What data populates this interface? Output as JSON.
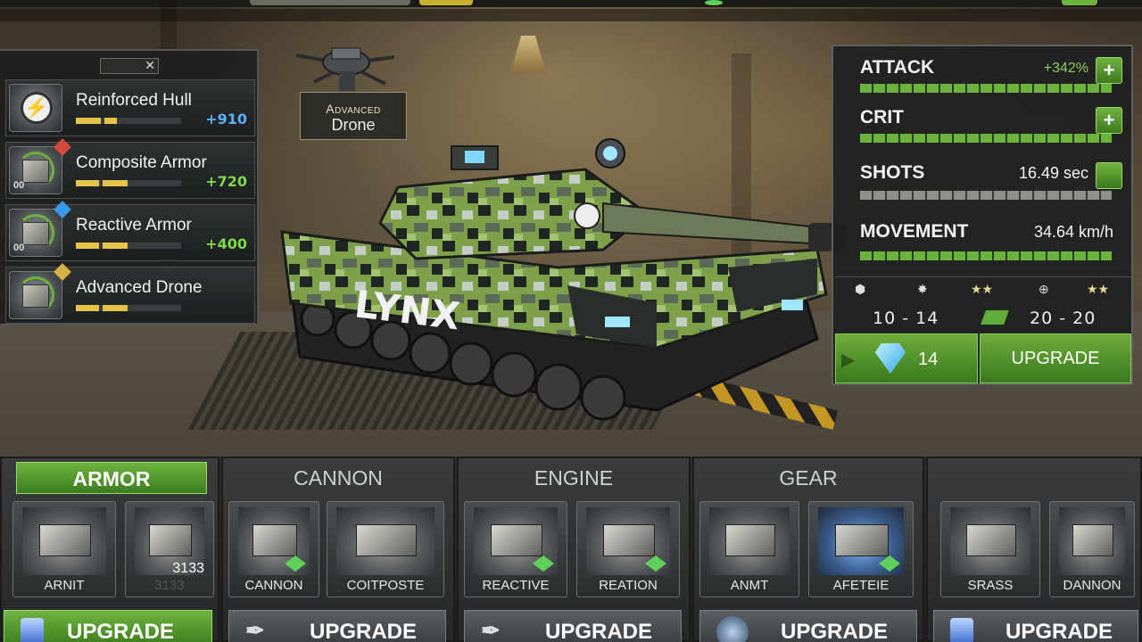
{
  "left_panel": {
    "parts": [
      {
        "name": "Reinforced Hull",
        "bonus": "+910",
        "bonus_color": "#5ab0ff",
        "level": ""
      },
      {
        "name": "Composite Armor",
        "bonus": "+720",
        "bonus_color": "#7fd84a",
        "level": "00"
      },
      {
        "name": "Reactive Armor",
        "bonus": "+400",
        "bonus_color": "#7fd84a",
        "level": "00"
      },
      {
        "name": "Advanced Drone",
        "bonus": "",
        "bonus_color": "#7fd84a",
        "level": ""
      }
    ]
  },
  "drone_label": {
    "line1": "Advanced",
    "line2": "Drone"
  },
  "tank": {
    "name": "LYNX"
  },
  "stats": {
    "attack": {
      "label": "ATTACK",
      "value": "+342%"
    },
    "crit": {
      "label": "CRIT",
      "value": ""
    },
    "shots": {
      "label": "SHOTS",
      "value": "16.49 sec"
    },
    "movement": {
      "label": "MOVEMENT",
      "value": "34.64 km/h"
    },
    "icon_row": [
      "★★",
      "★★"
    ],
    "range_left": "10 - 14",
    "range_right": "20 - 20",
    "gem_count": "14",
    "upgrade_label": "UPGRADE"
  },
  "categories": [
    {
      "title": "ARMOR",
      "cards": [
        {
          "name": "ARNIT",
          "count": ""
        },
        {
          "name": "3133",
          "count": "3133"
        }
      ],
      "upgrade_label": "UPGRADE"
    },
    {
      "title": "CANNON",
      "cards": [
        {
          "name": "CANNON",
          "count": ""
        },
        {
          "name": "COITPOSTE",
          "count": ""
        }
      ],
      "upgrade_label": "UPGRADE"
    },
    {
      "title": "ENGINE",
      "cards": [
        {
          "name": "REACTIVE",
          "count": ""
        },
        {
          "name": "REATION",
          "count": ""
        }
      ],
      "upgrade_label": "UPGRADE"
    },
    {
      "title": "GEAR",
      "cards": [
        {
          "name": "ANMT",
          "count": ""
        },
        {
          "name": "AFETEIE",
          "count": ""
        }
      ],
      "upgrade_label": "UPGRADE"
    },
    {
      "title": "",
      "cards": [
        {
          "name": "SRASS",
          "count": ""
        },
        {
          "name": "DANNON",
          "count": ""
        }
      ],
      "upgrade_label": "UPGRADE"
    }
  ],
  "colors": {
    "accent_green": "#6db33f",
    "panel_bg": "#1e2021"
  }
}
